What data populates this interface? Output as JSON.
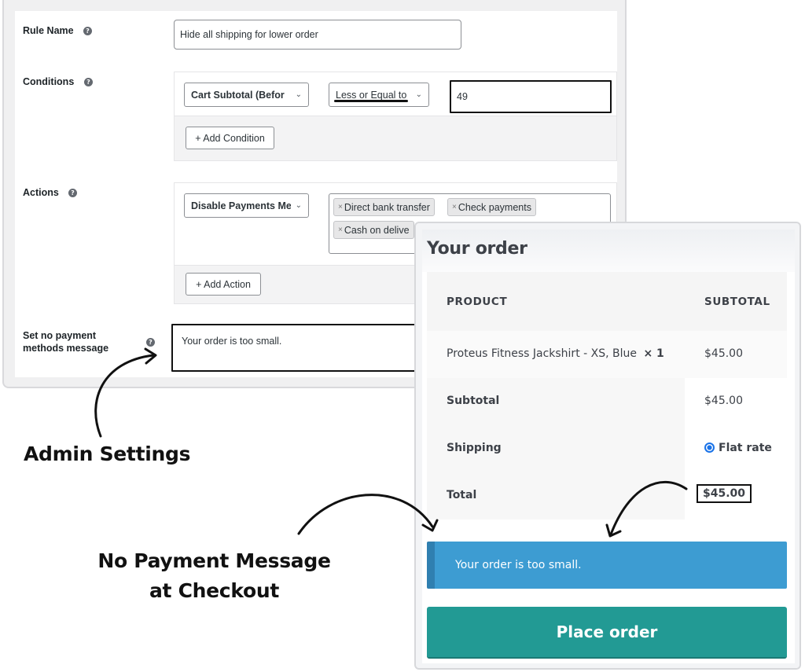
{
  "admin": {
    "rule_name": {
      "label": "Rule Name",
      "help_icon": "help-icon",
      "value": "Hide all shipping for lower order"
    },
    "conditions": {
      "label": "Conditions",
      "help_icon": "help-icon",
      "rows": [
        {
          "field": "Cart Subtotal (Before Discount)",
          "field_visible": "Cart Subtotal (Befor",
          "operator": "Less or Equal to",
          "value": "49"
        }
      ],
      "add_button": "+ Add Condition"
    },
    "actions": {
      "label": "Actions",
      "help_icon": "help-icon",
      "rows": [
        {
          "action": "Disable Payments Methods",
          "action_visible": "Disable Payments Me",
          "selected_methods": [
            "Direct bank transfer",
            "Check payments",
            "Cash on delivery"
          ],
          "selected_methods_visible": [
            "Direct bank transfer",
            "Check payments",
            "Cash on delive"
          ]
        }
      ],
      "add_button": "+ Add Action"
    },
    "no_payment_message": {
      "label_line1": "Set no payment",
      "label_line2": "methods message",
      "help_icon": "help-icon",
      "value": "Your order is too small."
    }
  },
  "checkout": {
    "title": "Your order",
    "columns": [
      "PRODUCT",
      "SUBTOTAL"
    ],
    "items": [
      {
        "name": "Proteus Fitness Jackshirt - XS, Blue",
        "qty": "× 1",
        "subtotal": "$45.00"
      }
    ],
    "subtotal_label": "Subtotal",
    "subtotal_value": "$45.00",
    "shipping_label": "Shipping",
    "shipping_option": "Flat rate",
    "shipping_selected": true,
    "total_label": "Total",
    "total_value": "$45.00",
    "notice": "Your order is too small.",
    "place_order": "Place order",
    "colors": {
      "notice_bg": "#3d9cd2",
      "place_order_bg": "#229a94",
      "radio": "#1a73e8"
    }
  },
  "annotations": {
    "admin_caption": "Admin Settings",
    "checkout_caption_line1": "No Payment Message",
    "checkout_caption_line2": "at Checkout"
  }
}
